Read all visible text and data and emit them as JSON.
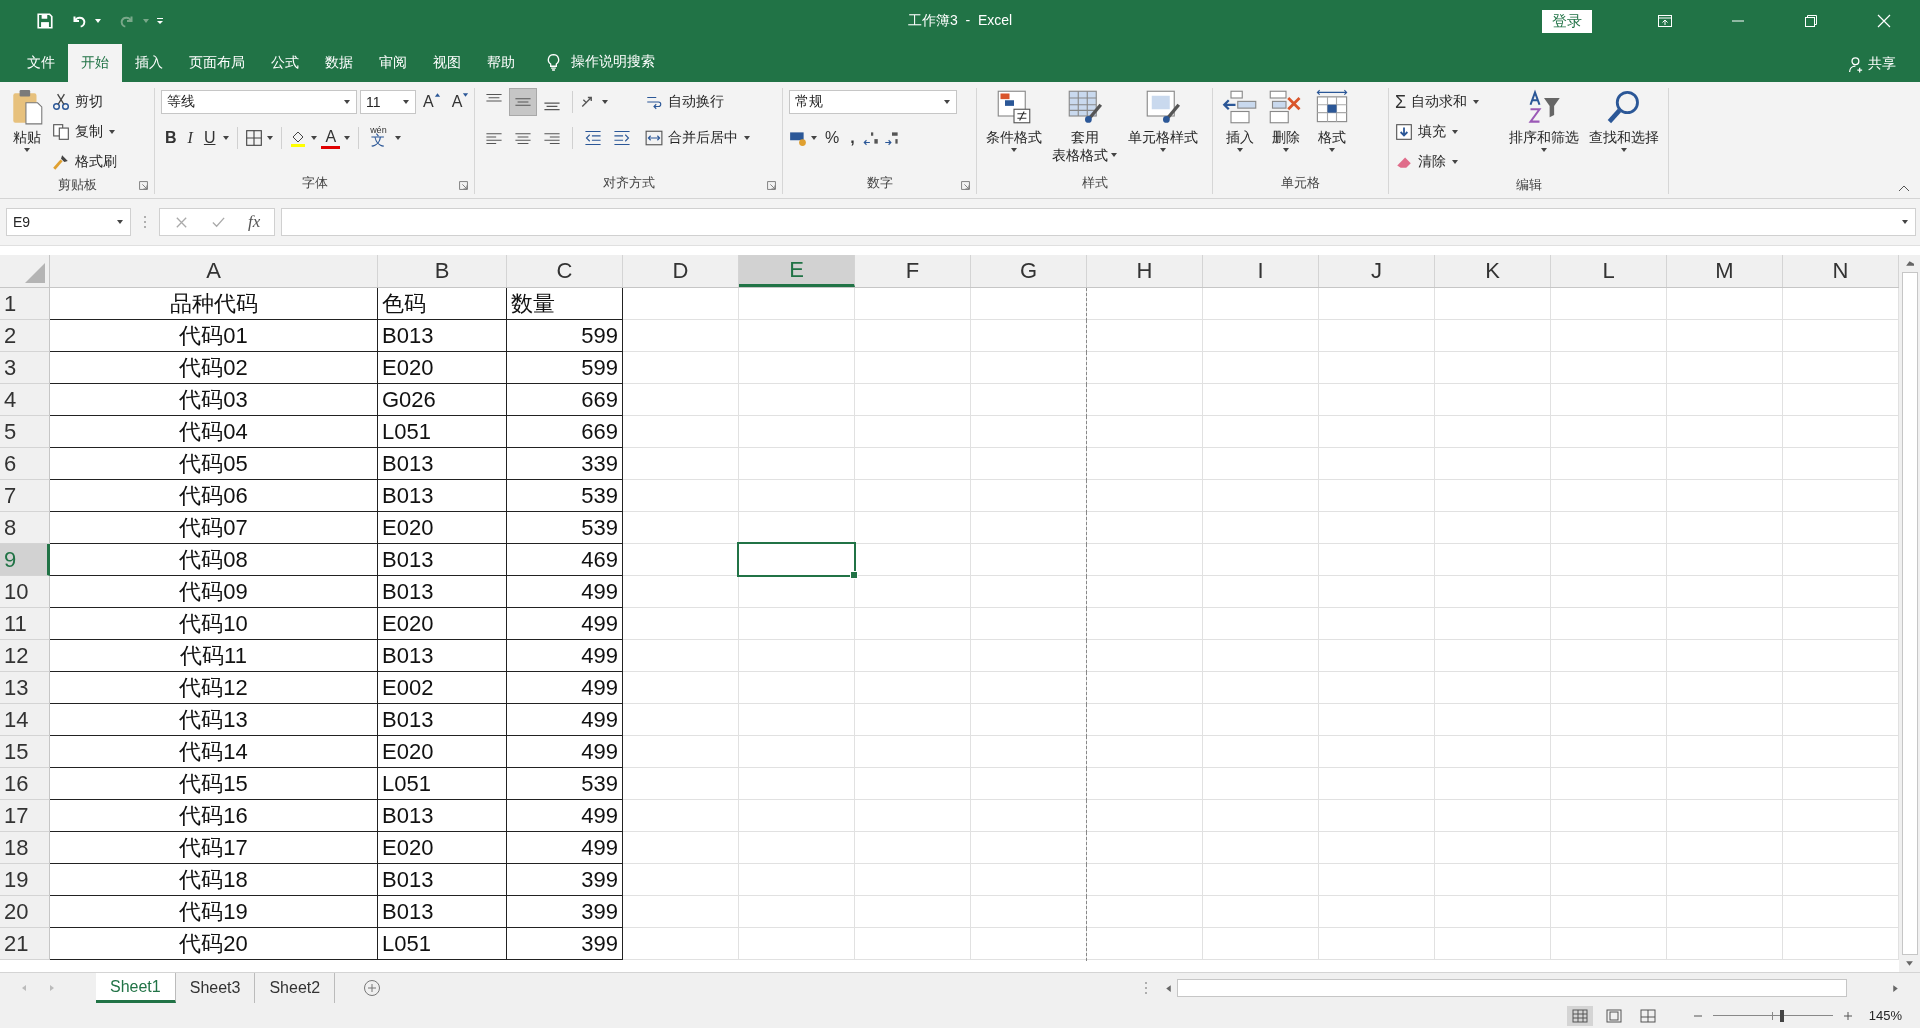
{
  "window": {
    "title": "工作簿3  -  Excel",
    "sign_in": "登录",
    "share": "共享"
  },
  "tabs": [
    {
      "label": "文件",
      "selected": false
    },
    {
      "label": "开始",
      "selected": true
    },
    {
      "label": "插入",
      "selected": false
    },
    {
      "label": "页面布局",
      "selected": false
    },
    {
      "label": "公式",
      "selected": false
    },
    {
      "label": "数据",
      "selected": false
    },
    {
      "label": "审阅",
      "selected": false
    },
    {
      "label": "视图",
      "selected": false
    },
    {
      "label": "帮助",
      "selected": false
    }
  ],
  "tell_me": "操作说明搜索",
  "clipboard": {
    "label": "剪贴板",
    "paste": "粘贴",
    "cut": "剪切",
    "copy": "复制",
    "format_painter": "格式刷"
  },
  "font": {
    "label": "字体",
    "name": "等线",
    "size": "11",
    "grow": "A",
    "shrink": "A",
    "bold": "B",
    "italic": "I",
    "underline": "U",
    "font_color": "A",
    "phonetic": [
      "wén",
      "文"
    ]
  },
  "alignment": {
    "label": "对齐方式",
    "wrap": "自动换行",
    "merge": "合并后居中",
    "middle_selected": true
  },
  "number": {
    "label": "数字",
    "format": "常规",
    "percent": "%",
    "comma": ","
  },
  "styles": {
    "label": "样式",
    "conditional": "条件格式",
    "table": [
      "套用",
      "表格格式"
    ],
    "cell_styles": "单元格样式"
  },
  "cells": {
    "label": "单元格",
    "insert": "插入",
    "delete": "删除",
    "format": "格式"
  },
  "editing": {
    "label": "编辑",
    "autosum_sign": "Σ",
    "autosum": "自动求和",
    "fill": "填充",
    "clear": "清除",
    "sort": "排序和筛选",
    "find": "查找和选择"
  },
  "formula_bar": {
    "name_box": "E9",
    "fx": "fx"
  },
  "columns": [
    {
      "label": "A",
      "selected": false,
      "page_break_after": false
    },
    {
      "label": "B",
      "selected": false,
      "page_break_after": false
    },
    {
      "label": "C",
      "selected": false,
      "page_break_after": false
    },
    {
      "label": "D",
      "selected": false,
      "page_break_after": false
    },
    {
      "label": "E",
      "selected": true,
      "page_break_after": false
    },
    {
      "label": "F",
      "selected": false,
      "page_break_after": false
    },
    {
      "label": "G",
      "selected": false,
      "page_break_after": true
    },
    {
      "label": "H",
      "selected": false,
      "page_break_after": false
    },
    {
      "label": "I",
      "selected": false,
      "page_break_after": false
    },
    {
      "label": "J",
      "selected": false,
      "page_break_after": false
    },
    {
      "label": "K",
      "selected": false,
      "page_break_after": false
    },
    {
      "label": "L",
      "selected": false,
      "page_break_after": false
    },
    {
      "label": "M",
      "selected": false,
      "page_break_after": false
    },
    {
      "label": "N",
      "selected": false,
      "page_break_after": false
    }
  ],
  "rows": [
    {
      "header": "1",
      "selected": false,
      "cells": [
        "品种代码",
        "色码",
        "数量"
      ]
    },
    {
      "header": "2",
      "selected": false,
      "cells": [
        "代码01",
        "B013",
        "599"
      ]
    },
    {
      "header": "3",
      "selected": false,
      "cells": [
        "代码02",
        "E020",
        "599"
      ]
    },
    {
      "header": "4",
      "selected": false,
      "cells": [
        "代码03",
        "G026",
        "669"
      ]
    },
    {
      "header": "5",
      "selected": false,
      "cells": [
        "代码04",
        "L051",
        "669"
      ]
    },
    {
      "header": "6",
      "selected": false,
      "cells": [
        "代码05",
        "B013",
        "339"
      ]
    },
    {
      "header": "7",
      "selected": false,
      "cells": [
        "代码06",
        "B013",
        "539"
      ]
    },
    {
      "header": "8",
      "selected": false,
      "cells": [
        "代码07",
        "E020",
        "539"
      ]
    },
    {
      "header": "9",
      "selected": true,
      "cells": [
        "代码08",
        "B013",
        "469"
      ]
    },
    {
      "header": "10",
      "selected": false,
      "cells": [
        "代码09",
        "B013",
        "499"
      ]
    },
    {
      "header": "11",
      "selected": false,
      "cells": [
        "代码10",
        "E020",
        "499"
      ]
    },
    {
      "header": "12",
      "selected": false,
      "cells": [
        "代码11",
        "B013",
        "499"
      ]
    },
    {
      "header": "13",
      "selected": false,
      "cells": [
        "代码12",
        "E002",
        "499"
      ]
    },
    {
      "header": "14",
      "selected": false,
      "cells": [
        "代码13",
        "B013",
        "499"
      ]
    },
    {
      "header": "15",
      "selected": false,
      "cells": [
        "代码14",
        "E020",
        "499"
      ]
    },
    {
      "header": "16",
      "selected": false,
      "cells": [
        "代码15",
        "L051",
        "539"
      ]
    },
    {
      "header": "17",
      "selected": false,
      "cells": [
        "代码16",
        "B013",
        "499"
      ]
    },
    {
      "header": "18",
      "selected": false,
      "cells": [
        "代码17",
        "E020",
        "499"
      ]
    },
    {
      "header": "19",
      "selected": false,
      "cells": [
        "代码18",
        "B013",
        "399"
      ]
    },
    {
      "header": "20",
      "selected": false,
      "cells": [
        "代码19",
        "B013",
        "399"
      ]
    },
    {
      "header": "21",
      "selected": false,
      "cells": [
        "代码20",
        "L051",
        "399"
      ]
    }
  ],
  "sheets": [
    {
      "label": "Sheet1",
      "selected": true
    },
    {
      "label": "Sheet3",
      "selected": false
    },
    {
      "label": "Sheet2",
      "selected": false
    }
  ],
  "status_bar": {
    "zoom": "145%",
    "zoom_slider": {
      "level": 0.56
    }
  }
}
